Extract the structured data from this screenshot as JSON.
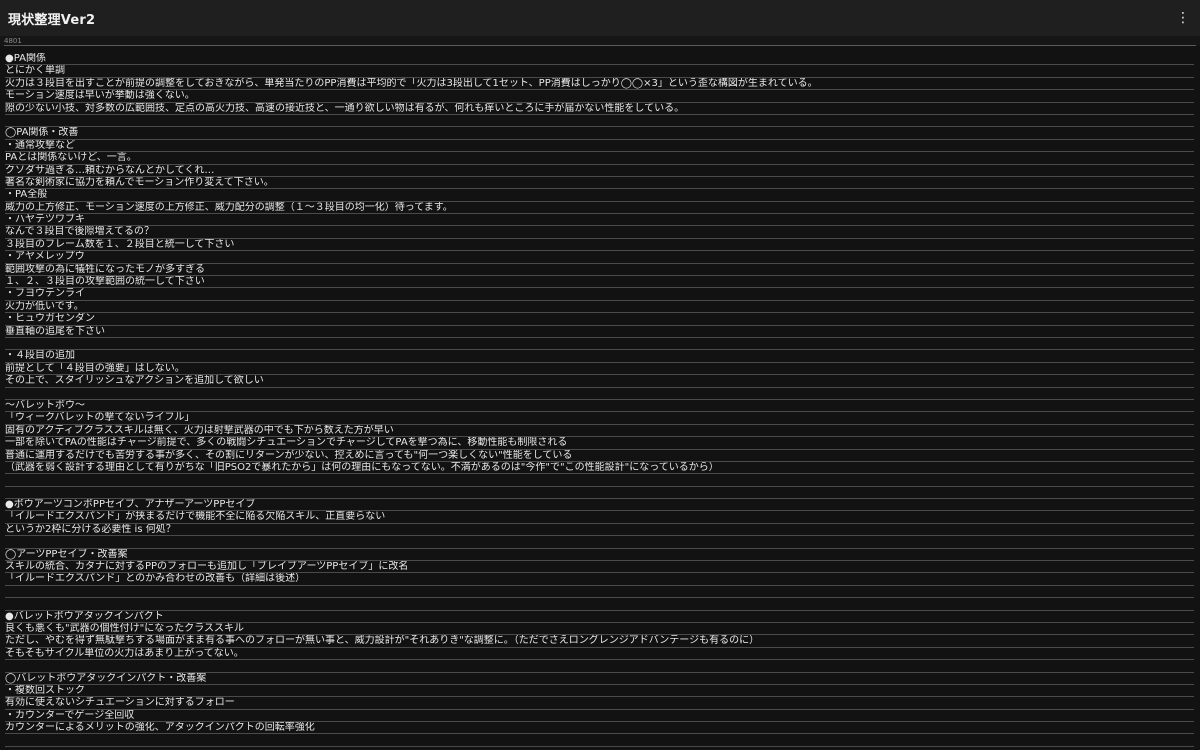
{
  "app_bar": {
    "title": "現状整理Ver2",
    "menu_icon": "more-vert-icon",
    "menu_glyph": "⋮"
  },
  "char_count": "4801",
  "colors": {
    "background": "#121212",
    "app_bar": "#1f1f1f",
    "text": "#e8e8e8",
    "rule": "#4a4a4a"
  },
  "document": {
    "lines": [
      "●PA関係",
      "とにかく単調",
      "火力は３段目を出すことが前提の調整をしておきながら、単発当たりのPP消費は平均的で「火力は3段出して1セット、PP消費はしっかり◯◯×3」という歪な構図が生まれている。",
      "モーション速度は早いが挙動は強くない。",
      "隙の少ない小技、対多数の広範囲技、定点の高火力技、高速の接近技と、一通り欲しい物は有るが、何れも痒いところに手が届かない性能をしている。",
      "",
      "◯PA関係・改善",
      "・通常攻撃など",
      "PAとは関係ないけど、一言。",
      "クソダサ過ぎる…頼むからなんとかしてくれ…",
      "著名な剣術家に協力を頼んでモーション作り変えて下さい。",
      "・PA全般",
      "威力の上方修正、モーション速度の上方修正、威力配分の調整（１〜３段目の均一化）待ってます。",
      "・ハヤテツワブキ",
      "なんで３段目で後隙増えてるの？",
      "３段目のフレーム数を１、２段目と統一して下さい",
      "・アヤメレップウ",
      "範囲攻撃の為に犠牲になったモノが多すぎる",
      "１、２、３段目の攻撃範囲の統一して下さい",
      "・フヨウテンライ",
      "火力が低いです。",
      "・ヒュウガセンダン",
      "垂直軸の追尾を下さい",
      "",
      "・４段目の追加",
      "前提として「４段目の強要」はしない。",
      "その上で、スタイリッシュなアクションを追加して欲しい",
      "",
      "〜バレットボウ〜",
      "「ウィークバレットの撃てないライフル」",
      "固有のアクティブクラススキルは無く、火力は射撃武器の中でも下から数えた方が早い",
      "一部を除いてPAの性能はチャージ前提で、多くの戦闘シチュエーションでチャージしてPAを撃つ為に、移動性能も制限される",
      "普通に運用するだけでも苦労する事が多く、その割にリターンが少ない、控えめに言っても\"何一つ楽しくない\"性能をしている",
      "（武器を弱く設計する理由として有りがちな「旧PSO2で暴れたから」は何の理由にもなってない。不満があるのは\"今作\"で\"この性能設計\"になっているから）",
      "",
      "",
      "●ボウアーツコンボPPセイブ、アナザーアーツPPセイブ",
      "「イルードエクスパンド」が挟まるだけで機能不全に陥る欠陥スキル、正直要らない",
      "というか2枠に分ける必要性 is 何処？",
      "",
      "◯アーツPPセイブ・改善案",
      "スキルの統合、カタナに対するPPのフォローも追加し「ブレイブアーツPPセイブ」に改名",
      "「イルードエクスパンド」とのかみ合わせの改善も（詳細は後述）",
      "",
      "",
      "●バレットボウアタックインパクト",
      "良くも悪くも\"武器の個性付け\"になったクラススキル",
      "ただし、やむを得ず無駄撃ちする場面がまま有る事へのフォローが無い事と、威力設計が\"それありき\"な調整に。（ただでさえロングレンジアドバンテージも有るのに）",
      "そもそもサイクル単位の火力はあまり上がってない。",
      "",
      "◯バレットボウアタックインパクト・改善案",
      "・複数回ストック",
      "有効に使えないシチュエーションに対するフォロー",
      "・カウンターでゲージ全回収",
      "カウンターによるメリットの強化、アタックインパクトの回転率強化",
      ""
    ]
  }
}
